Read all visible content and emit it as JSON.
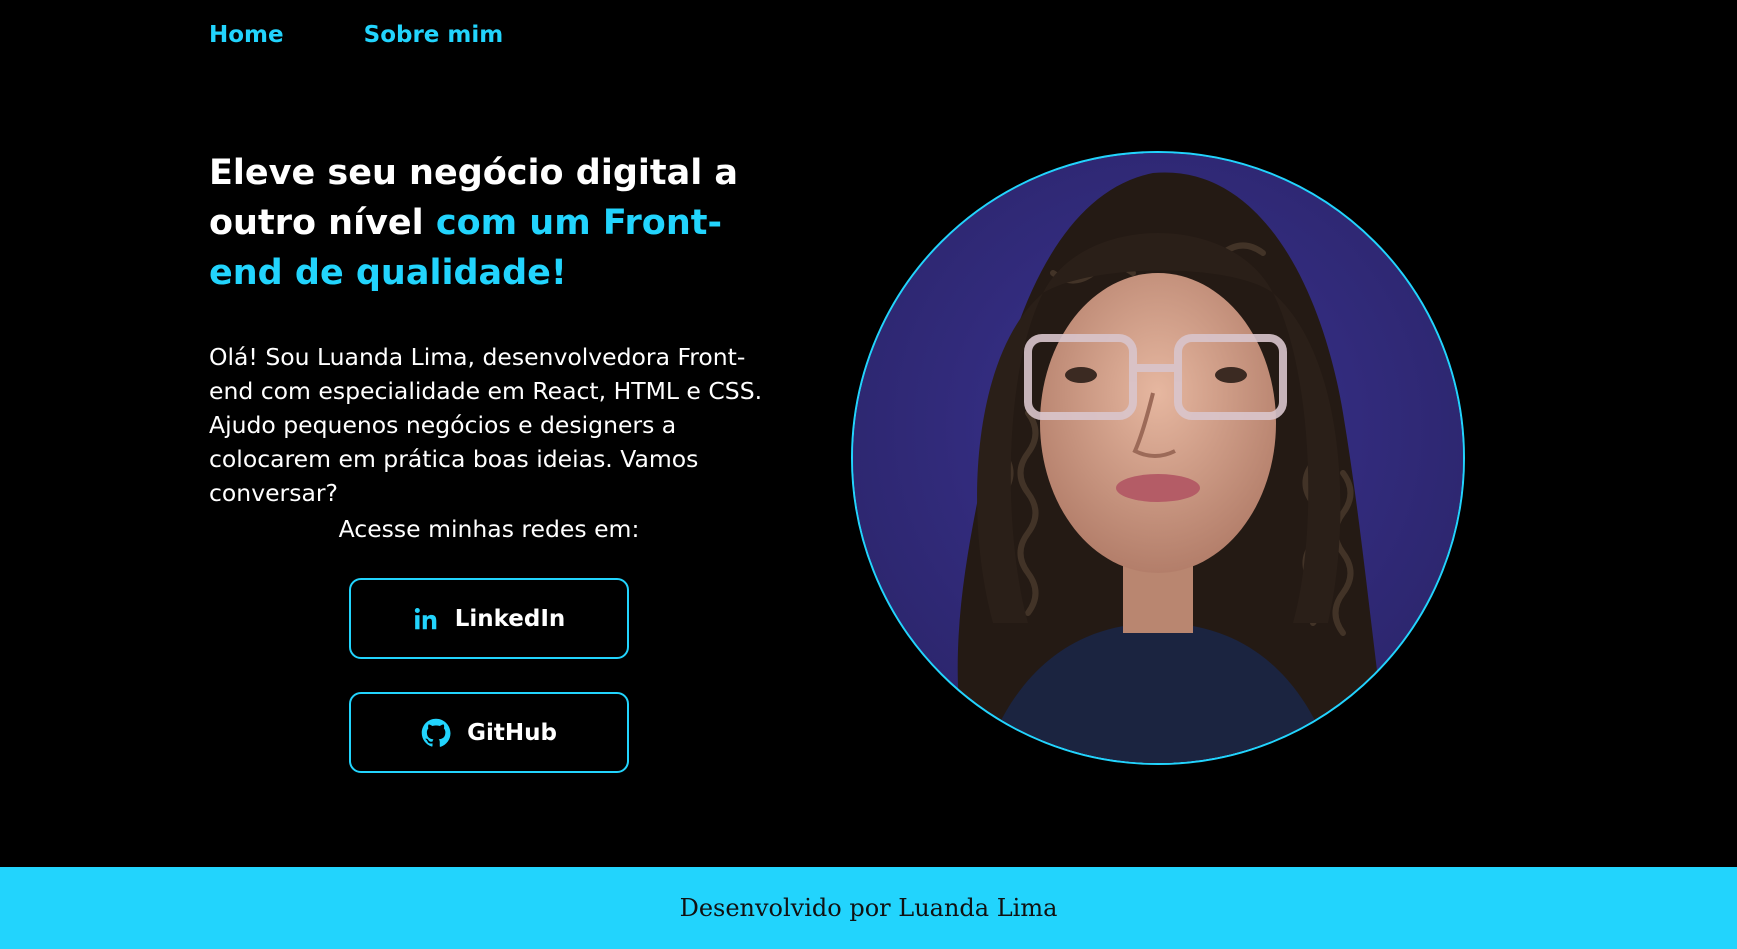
{
  "nav": {
    "items": [
      {
        "label": "Home"
      },
      {
        "label": "Sobre mim"
      }
    ]
  },
  "hero": {
    "headline_part1": "Eleve seu negócio digital a outro nível ",
    "headline_accent": "com um Front-end de qualidade!",
    "intro": "Olá! Sou Luanda Lima, desenvolvedora Front-end com especialidade em React, HTML e CSS. Ajudo pequenos negócios e designers a colocarem em prática boas ideias. Vamos conversar?",
    "socials_label": "Acesse minhas redes em:",
    "linkedin_label": "LinkedIn",
    "github_label": "GitHub",
    "linkedin_icon": "linkedin-icon",
    "github_icon": "github-icon"
  },
  "profile_photo": {
    "subject": "portrait"
  },
  "footer": {
    "text": "Desenvolvido por Luanda Lima"
  },
  "colors": {
    "background": "#000000",
    "accent": "#22d4fd",
    "text": "#ffffff",
    "photo_background": "#2e2870"
  }
}
